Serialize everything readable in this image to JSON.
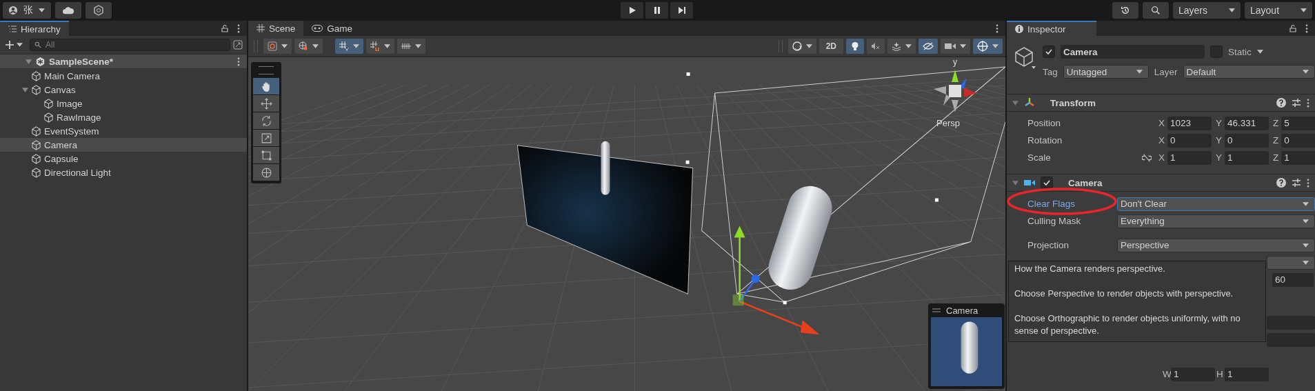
{
  "toolbar": {
    "account": "张",
    "layers": "Layers",
    "layout": "Layout"
  },
  "hierarchy": {
    "title": "Hierarchy",
    "search": {
      "placeholder": "All"
    },
    "scene": {
      "name": "SampleScene*",
      "expanded": true,
      "children": [
        {
          "name": "Main Camera",
          "selected": false
        },
        {
          "name": "Canvas",
          "selected": false,
          "expanded": true,
          "children": [
            {
              "name": "Image",
              "selected": false
            },
            {
              "name": "RawImage",
              "selected": false
            }
          ]
        },
        {
          "name": "EventSystem",
          "selected": false
        },
        {
          "name": "Camera",
          "selected": true
        },
        {
          "name": "Capsule",
          "selected": false
        },
        {
          "name": "Directional Light",
          "selected": false
        }
      ]
    }
  },
  "scene_view": {
    "tabs": [
      {
        "label": "Scene",
        "kind": "scene",
        "selected": true
      },
      {
        "label": "Game",
        "kind": "game",
        "selected": false
      }
    ],
    "left_toggles": [
      {
        "kind": "pivot",
        "on": false
      },
      {
        "kind": "global",
        "on": false
      },
      {
        "kind": "grid",
        "on": true
      },
      {
        "kind": "snap",
        "on": false
      },
      {
        "kind": "increment",
        "on": false
      }
    ],
    "right_toggles": [
      {
        "kind": "shading",
        "on": false
      },
      {
        "kind": "flat",
        "label": "2D",
        "on": false
      },
      {
        "kind": "light",
        "on": true
      },
      {
        "kind": "audio",
        "on": false
      },
      {
        "kind": "effects",
        "on": false
      },
      {
        "kind": "visibility",
        "on": true
      },
      {
        "kind": "camera",
        "on": false
      },
      {
        "kind": "gizmos",
        "on": true
      }
    ],
    "tools": [
      {
        "kind": "hand",
        "selected": true
      },
      {
        "kind": "move",
        "selected": false
      },
      {
        "kind": "rotate",
        "selected": false
      },
      {
        "kind": "scale",
        "selected": false
      },
      {
        "kind": "rect",
        "selected": false
      },
      {
        "kind": "transform",
        "selected": false
      }
    ],
    "axis_label": "y",
    "projection_label": "Persp",
    "preview": {
      "title": "Camera"
    }
  },
  "inspector": {
    "title": "Inspector",
    "object": {
      "active": true,
      "name": "Camera",
      "static": false,
      "static_label": "Static",
      "tag_label": "Tag",
      "tag": "Untagged",
      "layer_label": "Layer",
      "layer": "Default"
    },
    "transform": {
      "title": "Transform",
      "expanded": true,
      "rows": [
        {
          "label": "Position",
          "fields": [
            {
              "axis": "X",
              "value": "1023"
            },
            {
              "axis": "Y",
              "value": "46.331"
            },
            {
              "axis": "Z",
              "value": "5"
            }
          ]
        },
        {
          "label": "Rotation",
          "fields": [
            {
              "axis": "X",
              "value": "0"
            },
            {
              "axis": "Y",
              "value": "0"
            },
            {
              "axis": "Z",
              "value": "0"
            }
          ]
        },
        {
          "label": "Scale",
          "linked": false,
          "fields": [
            {
              "axis": "X",
              "value": "1"
            },
            {
              "axis": "Y",
              "value": "1"
            },
            {
              "axis": "Z",
              "value": "1"
            }
          ]
        }
      ]
    },
    "camera": {
      "title": "Camera",
      "expanded": true,
      "enabled": true,
      "properties": [
        {
          "kind": "dropdown",
          "label": "Clear Flags",
          "value": "Don't Clear",
          "focused": true
        },
        {
          "kind": "dropdown",
          "label": "Culling Mask",
          "value": "Everything",
          "focused": false
        },
        {
          "kind": "dropdown",
          "label": "Projection",
          "value": "Perspective",
          "focused": false
        },
        {
          "kind": "dropdown",
          "focused": false
        },
        {
          "kind": "number",
          "value": "60"
        },
        {
          "kind": "blank"
        },
        {
          "kind": "blank"
        },
        {
          "kind": "blank"
        },
        {
          "kind": "pair",
          "fields": [
            {
              "axis": "W",
              "value": "1"
            },
            {
              "axis": "H",
              "value": "1"
            }
          ]
        }
      ]
    },
    "tooltip": {
      "paragraphs": [
        "How the Camera renders perspective.",
        "Choose Perspective to render objects with perspective.",
        "Choose Orthographic to render objects uniformly, with no sense of perspective."
      ]
    }
  }
}
